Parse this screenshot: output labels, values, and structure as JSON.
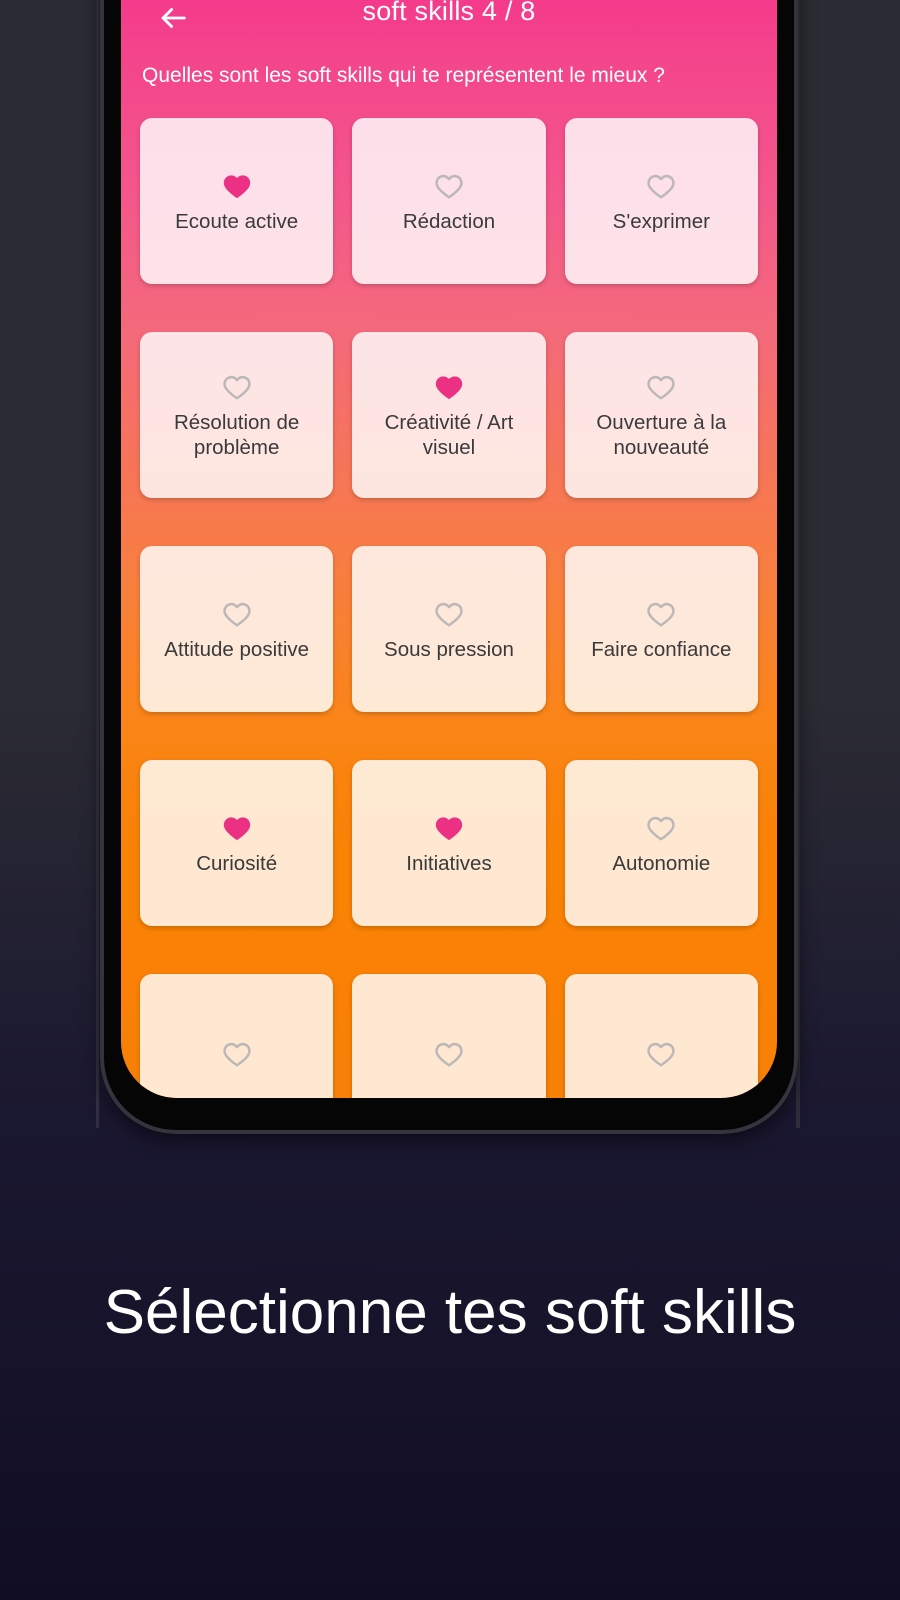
{
  "screen": {
    "appbar": {
      "back_icon": "arrow-left-icon",
      "title": "soft skills 4 / 8"
    },
    "prompt": "Quelles sont les soft skills qui te représentent le mieux ?",
    "cards": [
      {
        "label": "Ecoute active",
        "selected": true,
        "icon": "heart-filled-icon"
      },
      {
        "label": "Rédaction",
        "selected": false,
        "icon": "heart-outline-icon"
      },
      {
        "label": "S'exprimer",
        "selected": false,
        "icon": "heart-outline-icon"
      },
      {
        "label": "Résolution de problème",
        "selected": false,
        "icon": "heart-outline-icon"
      },
      {
        "label": "Créativité / Art visuel",
        "selected": true,
        "icon": "heart-filled-icon"
      },
      {
        "label": "Ouverture à la nouveauté",
        "selected": false,
        "icon": "heart-outline-icon"
      },
      {
        "label": "Attitude positive",
        "selected": false,
        "icon": "heart-outline-icon"
      },
      {
        "label": "Sous pression",
        "selected": false,
        "icon": "heart-outline-icon"
      },
      {
        "label": "Faire confiance",
        "selected": false,
        "icon": "heart-outline-icon"
      },
      {
        "label": "Curiosité",
        "selected": true,
        "icon": "heart-filled-icon"
      },
      {
        "label": "Initiatives",
        "selected": true,
        "icon": "heart-filled-icon"
      },
      {
        "label": "Autonomie",
        "selected": false,
        "icon": "heart-outline-icon"
      },
      {
        "label": "",
        "selected": false,
        "icon": "heart-outline-icon"
      },
      {
        "label": "",
        "selected": false,
        "icon": "heart-outline-icon"
      },
      {
        "label": "",
        "selected": false,
        "icon": "heart-outline-icon"
      }
    ]
  },
  "caption": "Sélectionne tes soft skills",
  "colors": {
    "gradient_top": "#f5358b",
    "gradient_bottom": "#f98006",
    "heart_selected": "#ec3084",
    "heart_unselected": "#bdb8b8",
    "card_text": "#3a3a3a",
    "page_background": "#17142c"
  }
}
